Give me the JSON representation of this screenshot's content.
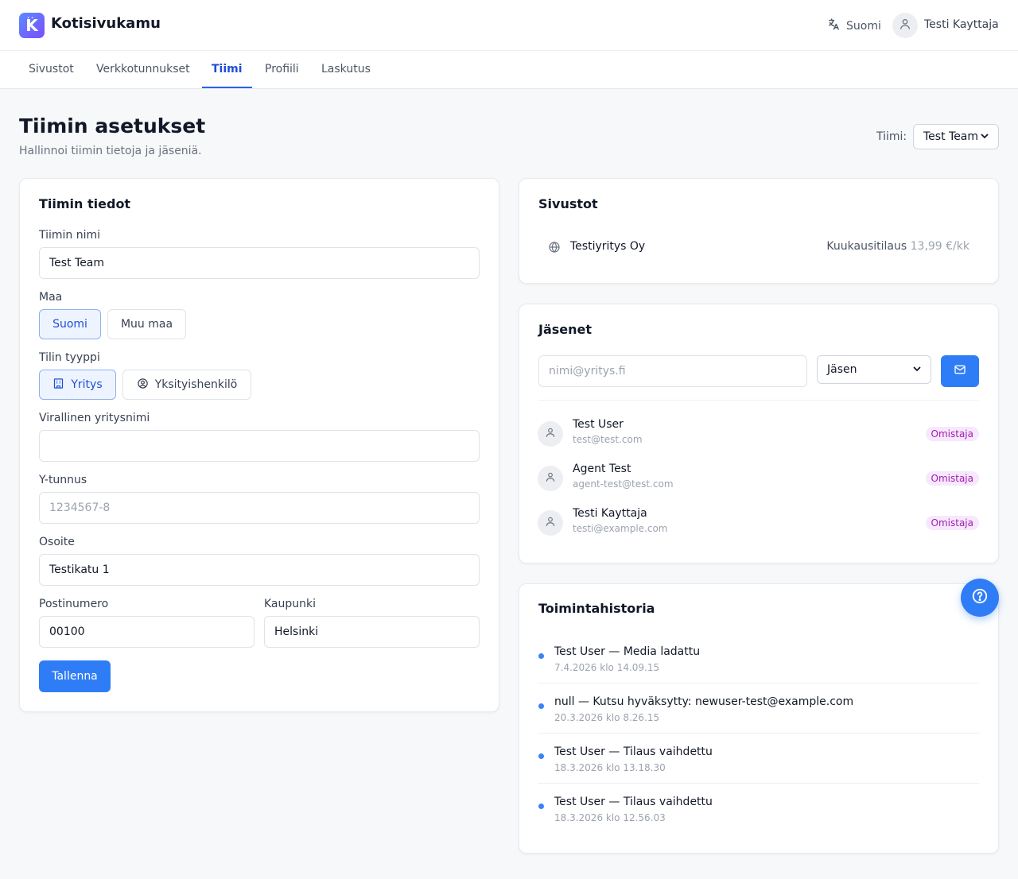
{
  "app": {
    "brand": "Kotisivukamu",
    "logo_letter": "K",
    "language": "Suomi",
    "user_name": "Testi Kayttaja"
  },
  "nav": {
    "tabs": [
      {
        "label": "Sivustot"
      },
      {
        "label": "Verkkotunnukset"
      },
      {
        "label": "Tiimi",
        "active": true
      },
      {
        "label": "Profiili"
      },
      {
        "label": "Laskutus"
      }
    ]
  },
  "page": {
    "title": "Tiimin asetukset",
    "subtitle": "Hallinnoi tiimin tietoja ja jäseniä.",
    "team_label": "Tiimi:",
    "team_selected": "Test Team"
  },
  "team_info": {
    "title": "Tiimin tiedot",
    "name_label": "Tiimin nimi",
    "name_value": "Test Team",
    "country_label": "Maa",
    "country_options": [
      "Suomi",
      "Muu maa"
    ],
    "country_selected": "Suomi",
    "account_type_label": "Tilin tyyppi",
    "account_type_options": [
      "Yritys",
      "Yksityishenkilö"
    ],
    "account_type_selected": "Yritys",
    "company_name_label": "Virallinen yritysnimi",
    "company_name_value": "",
    "business_id_label": "Y-tunnus",
    "business_id_placeholder": "1234567-8",
    "address_label": "Osoite",
    "address_value": "Testikatu 1",
    "postal_label": "Postinumero",
    "postal_value": "00100",
    "city_label": "Kaupunki",
    "city_value": "Helsinki",
    "save_label": "Tallenna"
  },
  "sites": {
    "title": "Sivustot",
    "items": [
      {
        "name": "Testiyritys Oy",
        "plan": "Kuukausitilaus",
        "price": "13,99 €/kk"
      }
    ]
  },
  "members": {
    "title": "Jäsenet",
    "invite_placeholder": "nimi@yritys.fi",
    "role_selected": "Jäsen",
    "list": [
      {
        "name": "Test User",
        "email": "test@test.com",
        "role": "Omistaja"
      },
      {
        "name": "Agent Test",
        "email": "agent-test@test.com",
        "role": "Omistaja"
      },
      {
        "name": "Testi Kayttaja",
        "email": "testi@example.com",
        "role": "Omistaja"
      }
    ]
  },
  "activity": {
    "title": "Toimintahistoria",
    "items": [
      {
        "text": "Test User — Media ladattu",
        "time": "7.4.2026 klo 14.09.15"
      },
      {
        "text": "null — Kutsu hyväksytty: newuser-test@example.com",
        "time": "20.3.2026 klo 8.26.15"
      },
      {
        "text": "Test User — Tilaus vaihdettu",
        "time": "18.3.2026 klo 13.18.30"
      },
      {
        "text": "Test User — Tilaus vaihdettu",
        "time": "18.3.2026 klo 12.56.03"
      }
    ]
  },
  "colors": {
    "primary": "#2f7df6",
    "active_tab": "#1d4ed8",
    "badge_bg": "#f7e8fd",
    "badge_text": "#a21caf"
  }
}
